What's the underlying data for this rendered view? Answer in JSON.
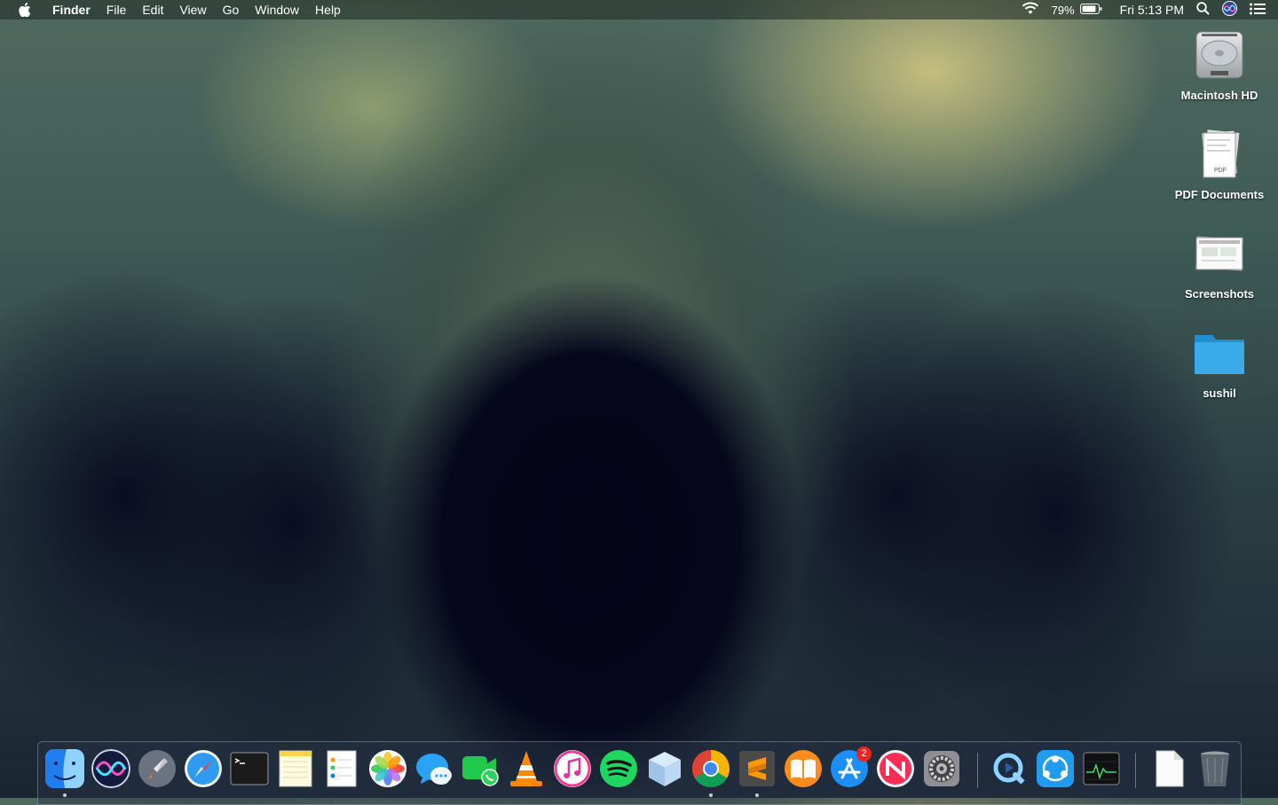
{
  "menubar": {
    "app_name": "Finder",
    "menus": [
      "File",
      "Edit",
      "View",
      "Go",
      "Window",
      "Help"
    ],
    "battery_percent": "79%",
    "clock": "Fri 5:13 PM",
    "icons": [
      "apple-icon",
      "wifi-icon",
      "battery-icon",
      "spotlight-icon",
      "siri-icon",
      "notification-center-icon"
    ]
  },
  "desktop": {
    "items": [
      {
        "label": "Macintosh HD",
        "icon": "hard-drive-icon"
      },
      {
        "label": "PDF Documents",
        "icon": "pdf-stack-icon"
      },
      {
        "label": "Screenshots",
        "icon": "screenshots-stack-icon"
      },
      {
        "label": "sushil",
        "icon": "folder-icon"
      }
    ]
  },
  "dock": {
    "apps": [
      {
        "name": "Finder",
        "icon": "finder-icon",
        "running": true
      },
      {
        "name": "Siri",
        "icon": "siri-icon",
        "running": false
      },
      {
        "name": "Launchpad",
        "icon": "launchpad-icon",
        "running": false
      },
      {
        "name": "Safari",
        "icon": "safari-icon",
        "running": false
      },
      {
        "name": "Terminal",
        "icon": "terminal-icon",
        "running": false
      },
      {
        "name": "Notes",
        "icon": "notes-icon",
        "running": false
      },
      {
        "name": "Reminders",
        "icon": "reminders-icon",
        "running": false
      },
      {
        "name": "Photos",
        "icon": "photos-icon",
        "running": false
      },
      {
        "name": "Messages",
        "icon": "messages-icon",
        "running": false
      },
      {
        "name": "FaceTime",
        "icon": "facetime-icon",
        "running": false
      },
      {
        "name": "VLC",
        "icon": "vlc-icon",
        "running": false
      },
      {
        "name": "iTunes",
        "icon": "itunes-icon",
        "running": false
      },
      {
        "name": "Spotify",
        "icon": "spotify-icon",
        "running": false
      },
      {
        "name": "Cube",
        "icon": "cube-icon",
        "running": false
      },
      {
        "name": "Google Chrome",
        "icon": "chrome-icon",
        "running": true
      },
      {
        "name": "Sublime Text",
        "icon": "sublime-icon",
        "running": true
      },
      {
        "name": "Books",
        "icon": "books-icon",
        "running": false
      },
      {
        "name": "App Store",
        "icon": "app-store-icon",
        "running": false,
        "badge": "2"
      },
      {
        "name": "News",
        "icon": "news-icon",
        "running": false
      },
      {
        "name": "System Preferences",
        "icon": "system-preferences-icon",
        "running": false
      },
      {
        "name": "QuickTime Player",
        "icon": "quicktime-icon",
        "running": false
      },
      {
        "name": "SHAREit",
        "icon": "shareit-icon",
        "running": false
      },
      {
        "name": "Activity Monitor",
        "icon": "activity-monitor-icon",
        "running": false
      },
      {
        "name": "Document",
        "icon": "document-icon",
        "running": false
      },
      {
        "name": "Trash",
        "icon": "trash-icon",
        "running": false
      }
    ]
  }
}
